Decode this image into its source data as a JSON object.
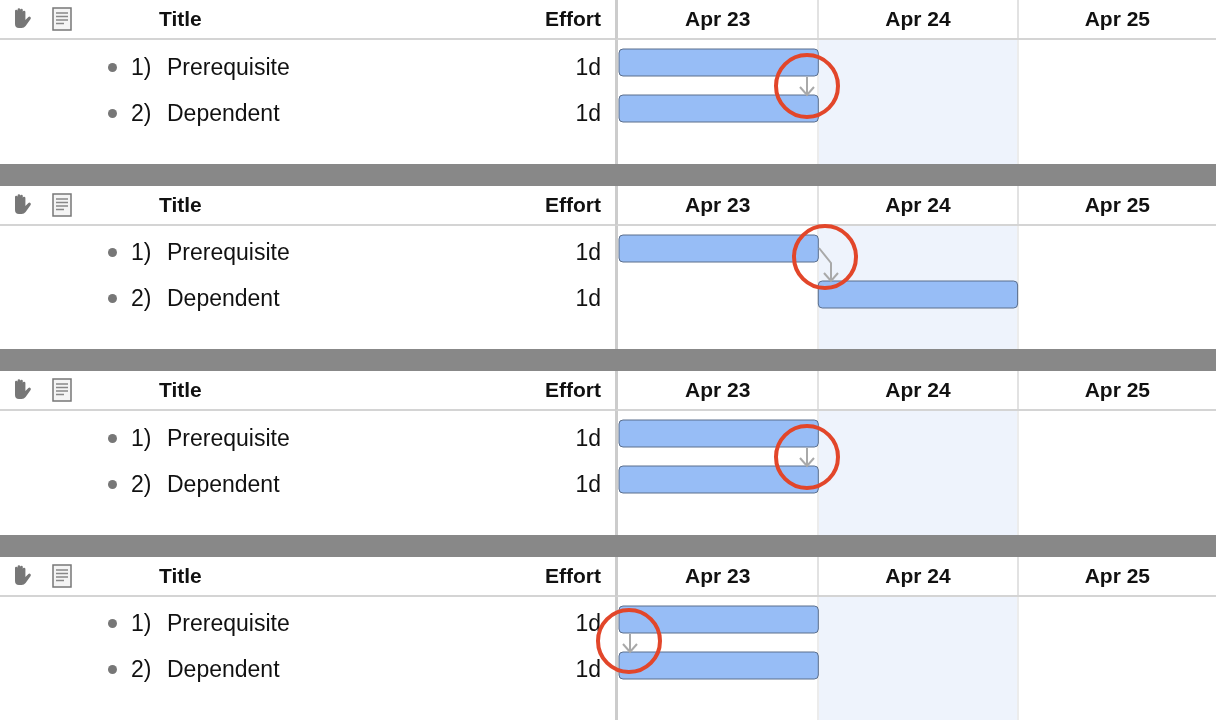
{
  "panels": [
    {
      "header": {
        "title": "Title",
        "effort": "Effort",
        "days": [
          {
            "label": "Apr 23",
            "shaded": false
          },
          {
            "label": "Apr 24",
            "shaded": true
          },
          {
            "label": "Apr 25",
            "shaded": false
          }
        ]
      },
      "rows": [
        {
          "number": "1)",
          "title": "Prerequisite",
          "effort": "1d"
        },
        {
          "number": "2)",
          "title": "Dependent",
          "effort": "1d"
        }
      ],
      "link": {
        "kind": "finish-to-finish",
        "highlighted": true
      }
    },
    {
      "header": {
        "title": "Title",
        "effort": "Effort",
        "days": [
          {
            "label": "Apr 23",
            "shaded": false
          },
          {
            "label": "Apr 24",
            "shaded": true
          },
          {
            "label": "Apr 25",
            "shaded": false
          }
        ]
      },
      "rows": [
        {
          "number": "1)",
          "title": "Prerequisite",
          "effort": "1d"
        },
        {
          "number": "2)",
          "title": "Dependent",
          "effort": "1d"
        }
      ],
      "link": {
        "kind": "finish-to-start",
        "highlighted": true
      }
    },
    {
      "header": {
        "title": "Title",
        "effort": "Effort",
        "days": [
          {
            "label": "Apr 23",
            "shaded": false
          },
          {
            "label": "Apr 24",
            "shaded": true
          },
          {
            "label": "Apr 25",
            "shaded": false
          }
        ]
      },
      "rows": [
        {
          "number": "1)",
          "title": "Prerequisite",
          "effort": "1d"
        },
        {
          "number": "2)",
          "title": "Dependent",
          "effort": "1d"
        }
      ],
      "link": {
        "kind": "finish-to-finish",
        "highlighted": true
      }
    },
    {
      "header": {
        "title": "Title",
        "effort": "Effort",
        "days": [
          {
            "label": "Apr 23",
            "shaded": false
          },
          {
            "label": "Apr 24",
            "shaded": true
          },
          {
            "label": "Apr 25",
            "shaded": false
          }
        ]
      },
      "rows": [
        {
          "number": "1)",
          "title": "Prerequisite",
          "effort": "1d"
        },
        {
          "number": "2)",
          "title": "Dependent",
          "effort": "1d"
        }
      ],
      "link": {
        "kind": "start-to-start",
        "highlighted": true
      }
    }
  ]
}
